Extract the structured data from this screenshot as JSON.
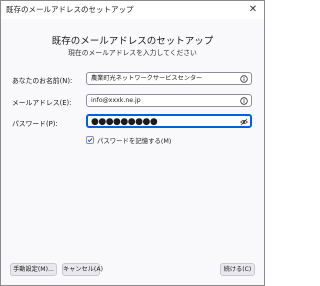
{
  "window": {
    "title": "既存のメールアドレスのセットアップ",
    "close_glyph": "✕"
  },
  "heading": "既存のメールアドレスのセットアップ",
  "subheading": "現在のメールアドレスを入力してください",
  "form": {
    "name_label": "あなたのお名前(N):",
    "name_value": "農業町光ネットワークサービスセンター",
    "email_label": "メールアドレス(E):",
    "email_value": "info@xxxk.ne.jp",
    "password_label": "パスワード(P):",
    "password_value": "●●●●●●●●●",
    "remember_label": "パスワードを記憶する(M)",
    "remember_checked": true
  },
  "buttons": {
    "manual": "手動設定(M)...",
    "cancel": "キャンセル(A)",
    "continue": "続ける(C)"
  },
  "colors": {
    "focus": "#0061e0",
    "checkmark": "#0061e0"
  }
}
